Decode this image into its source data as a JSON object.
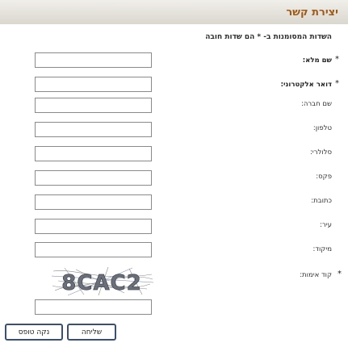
{
  "header": {
    "title": "יצירת קשר"
  },
  "note": "השדות המסומנות ב- * הם שדות חובה",
  "fields": [
    {
      "label": "שם מלא:",
      "required": true
    },
    {
      "label": "דואר אלקטרוני:",
      "required": true
    },
    {
      "label": "שם חברה:",
      "required": false
    },
    {
      "label": "טלפון:",
      "required": false
    },
    {
      "label": "סלולרי:",
      "required": false
    },
    {
      "label": "פקס:",
      "required": false
    },
    {
      "label": "כתובת:",
      "required": false
    },
    {
      "label": "עיר:",
      "required": false
    },
    {
      "label": "מיקוד:",
      "required": false
    },
    {
      "label": "קוד אימות:",
      "required": true
    }
  ],
  "captcha": {
    "text": "8CAC2"
  },
  "buttons": {
    "send": "שליחה",
    "reset": "נקה טופס"
  }
}
